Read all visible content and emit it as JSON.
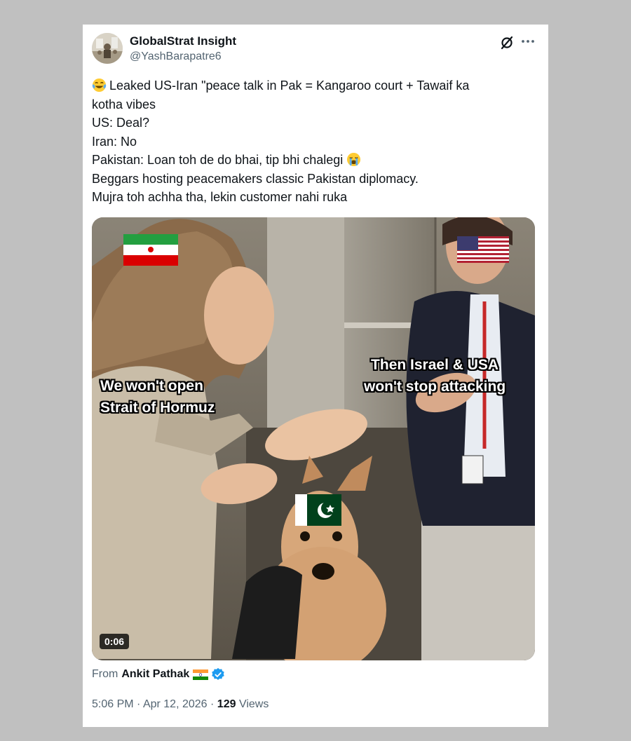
{
  "tweet": {
    "author_name": "GlobalStrat Insight",
    "author_handle": "@YashBarapatre6",
    "icons": {
      "grok": "grok-icon",
      "more": "more-icon"
    },
    "lines": [
      "Leaked US-Iran \"peace talk in Pak = Kangaroo court + Tawaif ka",
      "kotha vibes",
      "US: Deal?",
      "Iran: No",
      "Pakistan: Loan toh de do bhai, tip bhi chalegi",
      "Beggars hosting peacemakers  classic Pakistan diplomacy.",
      "Mujra toh achha tha, lekin customer nahi ruka"
    ],
    "emojis": {
      "line0": "face-with-tears-of-joy",
      "line4": "loudly-crying-face"
    }
  },
  "media": {
    "caption_left": [
      "We won't open",
      "Strait of Hormuz"
    ],
    "caption_right": [
      "Then Israel & USA",
      "won't stop attacking"
    ],
    "duration": "0:06",
    "flags": [
      "iran-flag",
      "usa-flag",
      "pakistan-flag"
    ]
  },
  "attribution": {
    "from_label": "From",
    "from_name": "Ankit Pathak",
    "flag": "india-flag",
    "badge": "verified-badge"
  },
  "meta": {
    "time": "5:06 PM",
    "separator": "·",
    "date": "Apr 12, 2026",
    "views_count": "129",
    "views_label": "Views"
  }
}
